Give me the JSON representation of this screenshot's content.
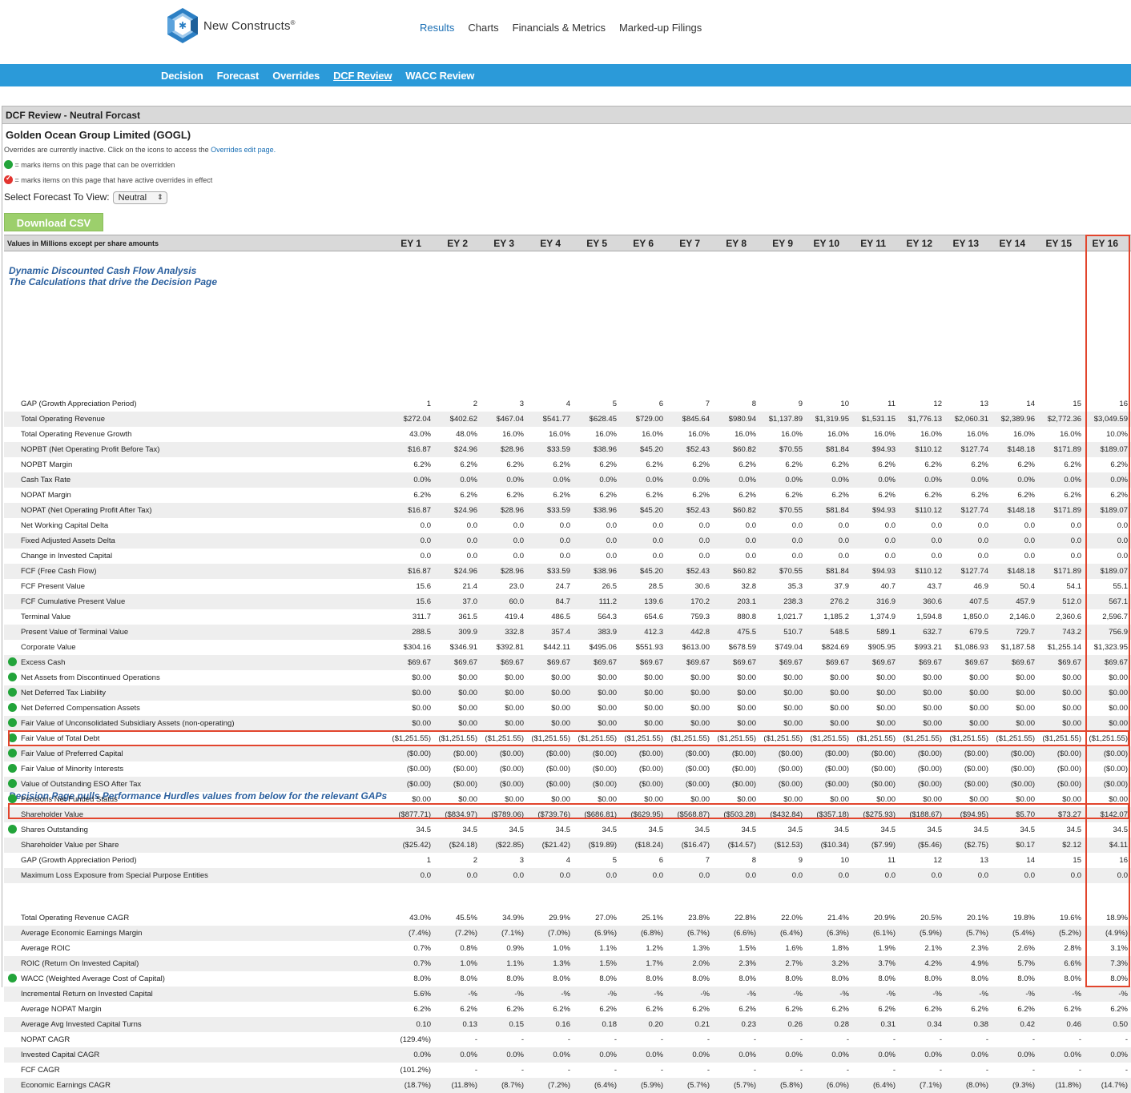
{
  "brand": {
    "name": "New Constructs",
    "mark": "®"
  },
  "topnav": [
    "Results",
    "Charts",
    "Financials & Metrics",
    "Marked-up Filings"
  ],
  "subnav": [
    "Decision",
    "Forecast",
    "Overrides",
    "DCF Review",
    "WACC Review"
  ],
  "panel": {
    "title": "DCF Review - Neutral Forcast",
    "company": "Golden Ocean Group Limited (GOGL)",
    "note1": "Overrides are currently inactive. Click on the icons to access the ",
    "note1_link": "Overrides edit page.",
    "note2": "= marks items on this page that can be overridden",
    "note3": "= marks items on this page that have active overrides in effect",
    "select_label": "Select Forecast To View:",
    "select_value": "Neutral",
    "csv_button": "Download CSV"
  },
  "table": {
    "header_label": "Values in Millions except per share amounts",
    "columns": [
      "EY 1",
      "EY 2",
      "EY 3",
      "EY 4",
      "EY 5",
      "EY 6",
      "EY 7",
      "EY 8",
      "EY 9",
      "EY 10",
      "EY 11",
      "EY 12",
      "EY 13",
      "EY 14",
      "EY 15",
      "EY 16"
    ],
    "section1_title": "Dynamic Discounted Cash Flow Analysis",
    "section1_sub": "The Calculations that drive the Decision Page",
    "section2_title": "Decision Page pulls Performance Hurdles values from below for the relevant GAPs",
    "rows1": [
      {
        "label": "GAP (Growth Appreciation Period)",
        "dot": false,
        "values": [
          "1",
          "2",
          "3",
          "4",
          "5",
          "6",
          "7",
          "8",
          "9",
          "10",
          "11",
          "12",
          "13",
          "14",
          "15",
          "16"
        ]
      },
      {
        "label": "Total Operating Revenue",
        "dot": false,
        "values": [
          "$272.04",
          "$402.62",
          "$467.04",
          "$541.77",
          "$628.45",
          "$729.00",
          "$845.64",
          "$980.94",
          "$1,137.89",
          "$1,319.95",
          "$1,531.15",
          "$1,776.13",
          "$2,060.31",
          "$2,389.96",
          "$2,772.36",
          "$3,049.59"
        ]
      },
      {
        "label": "Total Operating Revenue Growth",
        "dot": false,
        "values": [
          "43.0%",
          "48.0%",
          "16.0%",
          "16.0%",
          "16.0%",
          "16.0%",
          "16.0%",
          "16.0%",
          "16.0%",
          "16.0%",
          "16.0%",
          "16.0%",
          "16.0%",
          "16.0%",
          "16.0%",
          "10.0%"
        ]
      },
      {
        "label": "NOPBT (Net Operating Profit Before Tax)",
        "dot": false,
        "values": [
          "$16.87",
          "$24.96",
          "$28.96",
          "$33.59",
          "$38.96",
          "$45.20",
          "$52.43",
          "$60.82",
          "$70.55",
          "$81.84",
          "$94.93",
          "$110.12",
          "$127.74",
          "$148.18",
          "$171.89",
          "$189.07"
        ]
      },
      {
        "label": "NOPBT Margin",
        "dot": false,
        "values": [
          "6.2%",
          "6.2%",
          "6.2%",
          "6.2%",
          "6.2%",
          "6.2%",
          "6.2%",
          "6.2%",
          "6.2%",
          "6.2%",
          "6.2%",
          "6.2%",
          "6.2%",
          "6.2%",
          "6.2%",
          "6.2%"
        ]
      },
      {
        "label": "Cash Tax Rate",
        "dot": false,
        "values": [
          "0.0%",
          "0.0%",
          "0.0%",
          "0.0%",
          "0.0%",
          "0.0%",
          "0.0%",
          "0.0%",
          "0.0%",
          "0.0%",
          "0.0%",
          "0.0%",
          "0.0%",
          "0.0%",
          "0.0%",
          "0.0%"
        ]
      },
      {
        "label": "NOPAT Margin",
        "dot": false,
        "values": [
          "6.2%",
          "6.2%",
          "6.2%",
          "6.2%",
          "6.2%",
          "6.2%",
          "6.2%",
          "6.2%",
          "6.2%",
          "6.2%",
          "6.2%",
          "6.2%",
          "6.2%",
          "6.2%",
          "6.2%",
          "6.2%"
        ]
      },
      {
        "label": "NOPAT (Net Operating Profit After Tax)",
        "dot": false,
        "values": [
          "$16.87",
          "$24.96",
          "$28.96",
          "$33.59",
          "$38.96",
          "$45.20",
          "$52.43",
          "$60.82",
          "$70.55",
          "$81.84",
          "$94.93",
          "$110.12",
          "$127.74",
          "$148.18",
          "$171.89",
          "$189.07"
        ]
      },
      {
        "label": "Net Working Capital Delta",
        "dot": false,
        "values": [
          "0.0",
          "0.0",
          "0.0",
          "0.0",
          "0.0",
          "0.0",
          "0.0",
          "0.0",
          "0.0",
          "0.0",
          "0.0",
          "0.0",
          "0.0",
          "0.0",
          "0.0",
          "0.0"
        ]
      },
      {
        "label": "Fixed Adjusted Assets Delta",
        "dot": false,
        "values": [
          "0.0",
          "0.0",
          "0.0",
          "0.0",
          "0.0",
          "0.0",
          "0.0",
          "0.0",
          "0.0",
          "0.0",
          "0.0",
          "0.0",
          "0.0",
          "0.0",
          "0.0",
          "0.0"
        ]
      },
      {
        "label": "Change in Invested Capital",
        "dot": false,
        "values": [
          "0.0",
          "0.0",
          "0.0",
          "0.0",
          "0.0",
          "0.0",
          "0.0",
          "0.0",
          "0.0",
          "0.0",
          "0.0",
          "0.0",
          "0.0",
          "0.0",
          "0.0",
          "0.0"
        ]
      },
      {
        "label": "FCF (Free Cash Flow)",
        "dot": false,
        "values": [
          "$16.87",
          "$24.96",
          "$28.96",
          "$33.59",
          "$38.96",
          "$45.20",
          "$52.43",
          "$60.82",
          "$70.55",
          "$81.84",
          "$94.93",
          "$110.12",
          "$127.74",
          "$148.18",
          "$171.89",
          "$189.07"
        ]
      },
      {
        "label": "FCF Present Value",
        "dot": false,
        "values": [
          "15.6",
          "21.4",
          "23.0",
          "24.7",
          "26.5",
          "28.5",
          "30.6",
          "32.8",
          "35.3",
          "37.9",
          "40.7",
          "43.7",
          "46.9",
          "50.4",
          "54.1",
          "55.1"
        ]
      },
      {
        "label": "FCF Cumulative Present Value",
        "dot": false,
        "values": [
          "15.6",
          "37.0",
          "60.0",
          "84.7",
          "111.2",
          "139.6",
          "170.2",
          "203.1",
          "238.3",
          "276.2",
          "316.9",
          "360.6",
          "407.5",
          "457.9",
          "512.0",
          "567.1"
        ]
      },
      {
        "label": "Terminal Value",
        "dot": false,
        "values": [
          "311.7",
          "361.5",
          "419.4",
          "486.5",
          "564.3",
          "654.6",
          "759.3",
          "880.8",
          "1,021.7",
          "1,185.2",
          "1,374.9",
          "1,594.8",
          "1,850.0",
          "2,146.0",
          "2,360.6",
          "2,596.7"
        ]
      },
      {
        "label": "Present Value of Terminal Value",
        "dot": false,
        "values": [
          "288.5",
          "309.9",
          "332.8",
          "357.4",
          "383.9",
          "412.3",
          "442.8",
          "475.5",
          "510.7",
          "548.5",
          "589.1",
          "632.7",
          "679.5",
          "729.7",
          "743.2",
          "756.9"
        ]
      },
      {
        "label": "Corporate Value",
        "dot": false,
        "values": [
          "$304.16",
          "$346.91",
          "$392.81",
          "$442.11",
          "$495.06",
          "$551.93",
          "$613.00",
          "$678.59",
          "$749.04",
          "$824.69",
          "$905.95",
          "$993.21",
          "$1,086.93",
          "$1,187.58",
          "$1,255.14",
          "$1,323.95"
        ]
      },
      {
        "label": "Excess Cash",
        "dot": true,
        "values": [
          "$69.67",
          "$69.67",
          "$69.67",
          "$69.67",
          "$69.67",
          "$69.67",
          "$69.67",
          "$69.67",
          "$69.67",
          "$69.67",
          "$69.67",
          "$69.67",
          "$69.67",
          "$69.67",
          "$69.67",
          "$69.67"
        ]
      },
      {
        "label": "Net Assets from Discontinued Operations",
        "dot": true,
        "values": [
          "$0.00",
          "$0.00",
          "$0.00",
          "$0.00",
          "$0.00",
          "$0.00",
          "$0.00",
          "$0.00",
          "$0.00",
          "$0.00",
          "$0.00",
          "$0.00",
          "$0.00",
          "$0.00",
          "$0.00",
          "$0.00"
        ]
      },
      {
        "label": "Net Deferred Tax Liability",
        "dot": true,
        "values": [
          "$0.00",
          "$0.00",
          "$0.00",
          "$0.00",
          "$0.00",
          "$0.00",
          "$0.00",
          "$0.00",
          "$0.00",
          "$0.00",
          "$0.00",
          "$0.00",
          "$0.00",
          "$0.00",
          "$0.00",
          "$0.00"
        ]
      },
      {
        "label": "Net Deferred Compensation Assets",
        "dot": true,
        "values": [
          "$0.00",
          "$0.00",
          "$0.00",
          "$0.00",
          "$0.00",
          "$0.00",
          "$0.00",
          "$0.00",
          "$0.00",
          "$0.00",
          "$0.00",
          "$0.00",
          "$0.00",
          "$0.00",
          "$0.00",
          "$0.00"
        ]
      },
      {
        "label": "Fair Value of Unconsolidated Subsidiary Assets (non-operating)",
        "dot": true,
        "values": [
          "$0.00",
          "$0.00",
          "$0.00",
          "$0.00",
          "$0.00",
          "$0.00",
          "$0.00",
          "$0.00",
          "$0.00",
          "$0.00",
          "$0.00",
          "$0.00",
          "$0.00",
          "$0.00",
          "$0.00",
          "$0.00"
        ]
      },
      {
        "label": "Fair Value of Total Debt",
        "dot": true,
        "values": [
          "($1,251.55)",
          "($1,251.55)",
          "($1,251.55)",
          "($1,251.55)",
          "($1,251.55)",
          "($1,251.55)",
          "($1,251.55)",
          "($1,251.55)",
          "($1,251.55)",
          "($1,251.55)",
          "($1,251.55)",
          "($1,251.55)",
          "($1,251.55)",
          "($1,251.55)",
          "($1,251.55)",
          "($1,251.55)"
        ]
      },
      {
        "label": "Fair Value of Preferred Capital",
        "dot": true,
        "values": [
          "($0.00)",
          "($0.00)",
          "($0.00)",
          "($0.00)",
          "($0.00)",
          "($0.00)",
          "($0.00)",
          "($0.00)",
          "($0.00)",
          "($0.00)",
          "($0.00)",
          "($0.00)",
          "($0.00)",
          "($0.00)",
          "($0.00)",
          "($0.00)"
        ]
      },
      {
        "label": "Fair Value of Minority Interests",
        "dot": true,
        "values": [
          "($0.00)",
          "($0.00)",
          "($0.00)",
          "($0.00)",
          "($0.00)",
          "($0.00)",
          "($0.00)",
          "($0.00)",
          "($0.00)",
          "($0.00)",
          "($0.00)",
          "($0.00)",
          "($0.00)",
          "($0.00)",
          "($0.00)",
          "($0.00)"
        ]
      },
      {
        "label": "Value of Outstanding ESO After Tax",
        "dot": true,
        "values": [
          "($0.00)",
          "($0.00)",
          "($0.00)",
          "($0.00)",
          "($0.00)",
          "($0.00)",
          "($0.00)",
          "($0.00)",
          "($0.00)",
          "($0.00)",
          "($0.00)",
          "($0.00)",
          "($0.00)",
          "($0.00)",
          "($0.00)",
          "($0.00)"
        ]
      },
      {
        "label": "Pensions Net Funded Status",
        "dot": true,
        "values": [
          "$0.00",
          "$0.00",
          "$0.00",
          "$0.00",
          "$0.00",
          "$0.00",
          "$0.00",
          "$0.00",
          "$0.00",
          "$0.00",
          "$0.00",
          "$0.00",
          "$0.00",
          "$0.00",
          "$0.00",
          "$0.00"
        ]
      },
      {
        "label": "Shareholder Value",
        "dot": false,
        "values": [
          "($877.71)",
          "($834.97)",
          "($789.06)",
          "($739.76)",
          "($686.81)",
          "($629.95)",
          "($568.87)",
          "($503.28)",
          "($432.84)",
          "($357.18)",
          "($275.93)",
          "($188.67)",
          "($94.95)",
          "$5.70",
          "$73.27",
          "$142.07"
        ]
      },
      {
        "label": "Shares Outstanding",
        "dot": true,
        "values": [
          "34.5",
          "34.5",
          "34.5",
          "34.5",
          "34.5",
          "34.5",
          "34.5",
          "34.5",
          "34.5",
          "34.5",
          "34.5",
          "34.5",
          "34.5",
          "34.5",
          "34.5",
          "34.5"
        ]
      },
      {
        "label": "Shareholder Value per Share",
        "dot": false,
        "values": [
          "($25.42)",
          "($24.18)",
          "($22.85)",
          "($21.42)",
          "($19.89)",
          "($18.24)",
          "($16.47)",
          "($14.57)",
          "($12.53)",
          "($10.34)",
          "($7.99)",
          "($5.46)",
          "($2.75)",
          "$0.17",
          "$2.12",
          "$4.11"
        ]
      },
      {
        "label": "GAP (Growth Appreciation Period)",
        "dot": false,
        "values": [
          "1",
          "2",
          "3",
          "4",
          "5",
          "6",
          "7",
          "8",
          "9",
          "10",
          "11",
          "12",
          "13",
          "14",
          "15",
          "16"
        ]
      },
      {
        "label": "Maximum Loss Exposure from Special Purpose Entities",
        "dot": false,
        "values": [
          "0.0",
          "0.0",
          "0.0",
          "0.0",
          "0.0",
          "0.0",
          "0.0",
          "0.0",
          "0.0",
          "0.0",
          "0.0",
          "0.0",
          "0.0",
          "0.0",
          "0.0",
          "0.0"
        ]
      }
    ],
    "rows2": [
      {
        "label": "Total Operating Revenue CAGR",
        "dot": false,
        "values": [
          "43.0%",
          "45.5%",
          "34.9%",
          "29.9%",
          "27.0%",
          "25.1%",
          "23.8%",
          "22.8%",
          "22.0%",
          "21.4%",
          "20.9%",
          "20.5%",
          "20.1%",
          "19.8%",
          "19.6%",
          "18.9%"
        ]
      },
      {
        "label": "Average Economic Earnings Margin",
        "dot": false,
        "values": [
          "(7.4%)",
          "(7.2%)",
          "(7.1%)",
          "(7.0%)",
          "(6.9%)",
          "(6.8%)",
          "(6.7%)",
          "(6.6%)",
          "(6.4%)",
          "(6.3%)",
          "(6.1%)",
          "(5.9%)",
          "(5.7%)",
          "(5.4%)",
          "(5.2%)",
          "(4.9%)"
        ]
      },
      {
        "label": "Average ROIC",
        "dot": false,
        "values": [
          "0.7%",
          "0.8%",
          "0.9%",
          "1.0%",
          "1.1%",
          "1.2%",
          "1.3%",
          "1.5%",
          "1.6%",
          "1.8%",
          "1.9%",
          "2.1%",
          "2.3%",
          "2.6%",
          "2.8%",
          "3.1%"
        ]
      },
      {
        "label": "ROIC (Return On Invested Capital)",
        "dot": false,
        "values": [
          "0.7%",
          "1.0%",
          "1.1%",
          "1.3%",
          "1.5%",
          "1.7%",
          "2.0%",
          "2.3%",
          "2.7%",
          "3.2%",
          "3.7%",
          "4.2%",
          "4.9%",
          "5.7%",
          "6.6%",
          "7.3%"
        ]
      },
      {
        "label": "WACC (Weighted Average Cost of Capital)",
        "dot": true,
        "values": [
          "8.0%",
          "8.0%",
          "8.0%",
          "8.0%",
          "8.0%",
          "8.0%",
          "8.0%",
          "8.0%",
          "8.0%",
          "8.0%",
          "8.0%",
          "8.0%",
          "8.0%",
          "8.0%",
          "8.0%",
          "8.0%"
        ]
      },
      {
        "label": "Incremental Return on Invested Capital",
        "dot": false,
        "values": [
          "5.6%",
          "-%",
          "-%",
          "-%",
          "-%",
          "-%",
          "-%",
          "-%",
          "-%",
          "-%",
          "-%",
          "-%",
          "-%",
          "-%",
          "-%",
          "-%"
        ]
      },
      {
        "label": "Average NOPAT Margin",
        "dot": false,
        "values": [
          "6.2%",
          "6.2%",
          "6.2%",
          "6.2%",
          "6.2%",
          "6.2%",
          "6.2%",
          "6.2%",
          "6.2%",
          "6.2%",
          "6.2%",
          "6.2%",
          "6.2%",
          "6.2%",
          "6.2%",
          "6.2%"
        ]
      },
      {
        "label": "Average Avg Invested Capital Turns",
        "dot": false,
        "values": [
          "0.10",
          "0.13",
          "0.15",
          "0.16",
          "0.18",
          "0.20",
          "0.21",
          "0.23",
          "0.26",
          "0.28",
          "0.31",
          "0.34",
          "0.38",
          "0.42",
          "0.46",
          "0.50"
        ]
      },
      {
        "label": "NOPAT CAGR",
        "dot": false,
        "values": [
          "(129.4%)",
          "-",
          "-",
          "-",
          "-",
          "-",
          "-",
          "-",
          "-",
          "-",
          "-",
          "-",
          "-",
          "-",
          "-",
          "-"
        ]
      },
      {
        "label": "Invested Capital CAGR",
        "dot": false,
        "values": [
          "0.0%",
          "0.0%",
          "0.0%",
          "0.0%",
          "0.0%",
          "0.0%",
          "0.0%",
          "0.0%",
          "0.0%",
          "0.0%",
          "0.0%",
          "0.0%",
          "0.0%",
          "0.0%",
          "0.0%",
          "0.0%"
        ]
      },
      {
        "label": "FCF CAGR",
        "dot": false,
        "values": [
          "(101.2%)",
          "-",
          "-",
          "-",
          "-",
          "-",
          "-",
          "-",
          "-",
          "-",
          "-",
          "-",
          "-",
          "-",
          "-",
          "-"
        ]
      },
      {
        "label": "Economic Earnings CAGR",
        "dot": false,
        "values": [
          "(18.7%)",
          "(11.8%)",
          "(8.7%)",
          "(7.2%)",
          "(6.4%)",
          "(5.9%)",
          "(5.7%)",
          "(5.7%)",
          "(5.8%)",
          "(6.0%)",
          "(6.4%)",
          "(7.1%)",
          "(8.0%)",
          "(9.3%)",
          "(11.8%)",
          "(14.7%)"
        ]
      }
    ]
  }
}
